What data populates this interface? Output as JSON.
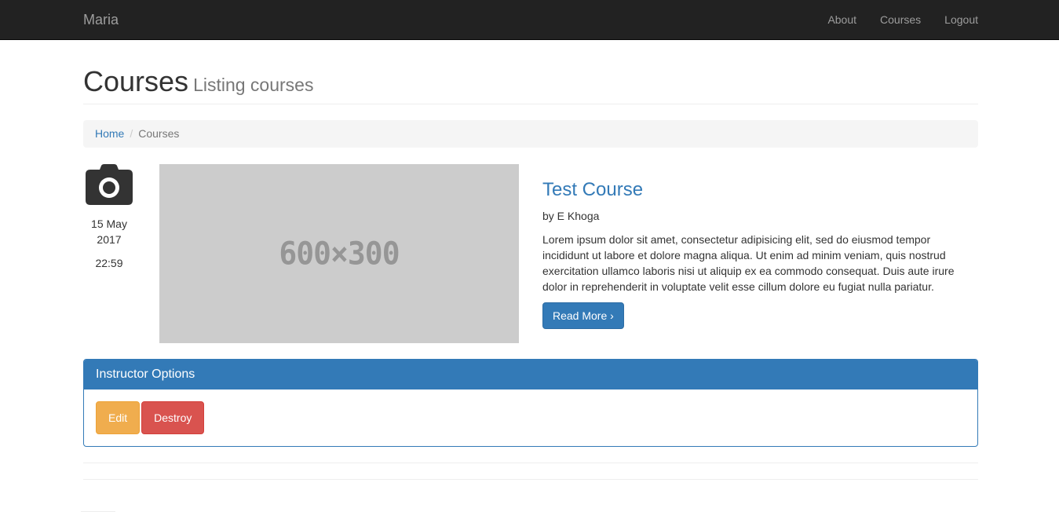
{
  "navbar": {
    "brand": "Maria",
    "links": [
      {
        "label": "About"
      },
      {
        "label": "Courses"
      },
      {
        "label": "Logout"
      }
    ]
  },
  "header": {
    "title": "Courses",
    "subtitle": "Listing courses"
  },
  "breadcrumb": {
    "home": "Home",
    "current": "Courses",
    "separator": "/"
  },
  "course": {
    "icon": "camera-icon",
    "date": "15 May 2017",
    "time": "22:59",
    "image_placeholder": "600×300",
    "title": "Test Course",
    "author": "by E Khoga",
    "description": "Lorem ipsum dolor sit amet, consectetur adipisicing elit, sed do eiusmod tempor incididunt ut labore et dolore magna aliqua. Ut enim ad minim veniam, quis nostrud exercitation ullamco laboris nisi ut aliquip ex ea commodo consequat. Duis aute irure dolor in reprehenderit in voluptate velit esse cillum dolore eu fugiat nulla pariatur.",
    "read_more": "Read More ›"
  },
  "instructor_panel": {
    "heading": "Instructor Options",
    "edit": "Edit",
    "destroy": "Destroy"
  },
  "colors": {
    "primary": "#337ab7",
    "warning": "#f0ad4e",
    "danger": "#d9534f",
    "navbar": "#222222"
  }
}
